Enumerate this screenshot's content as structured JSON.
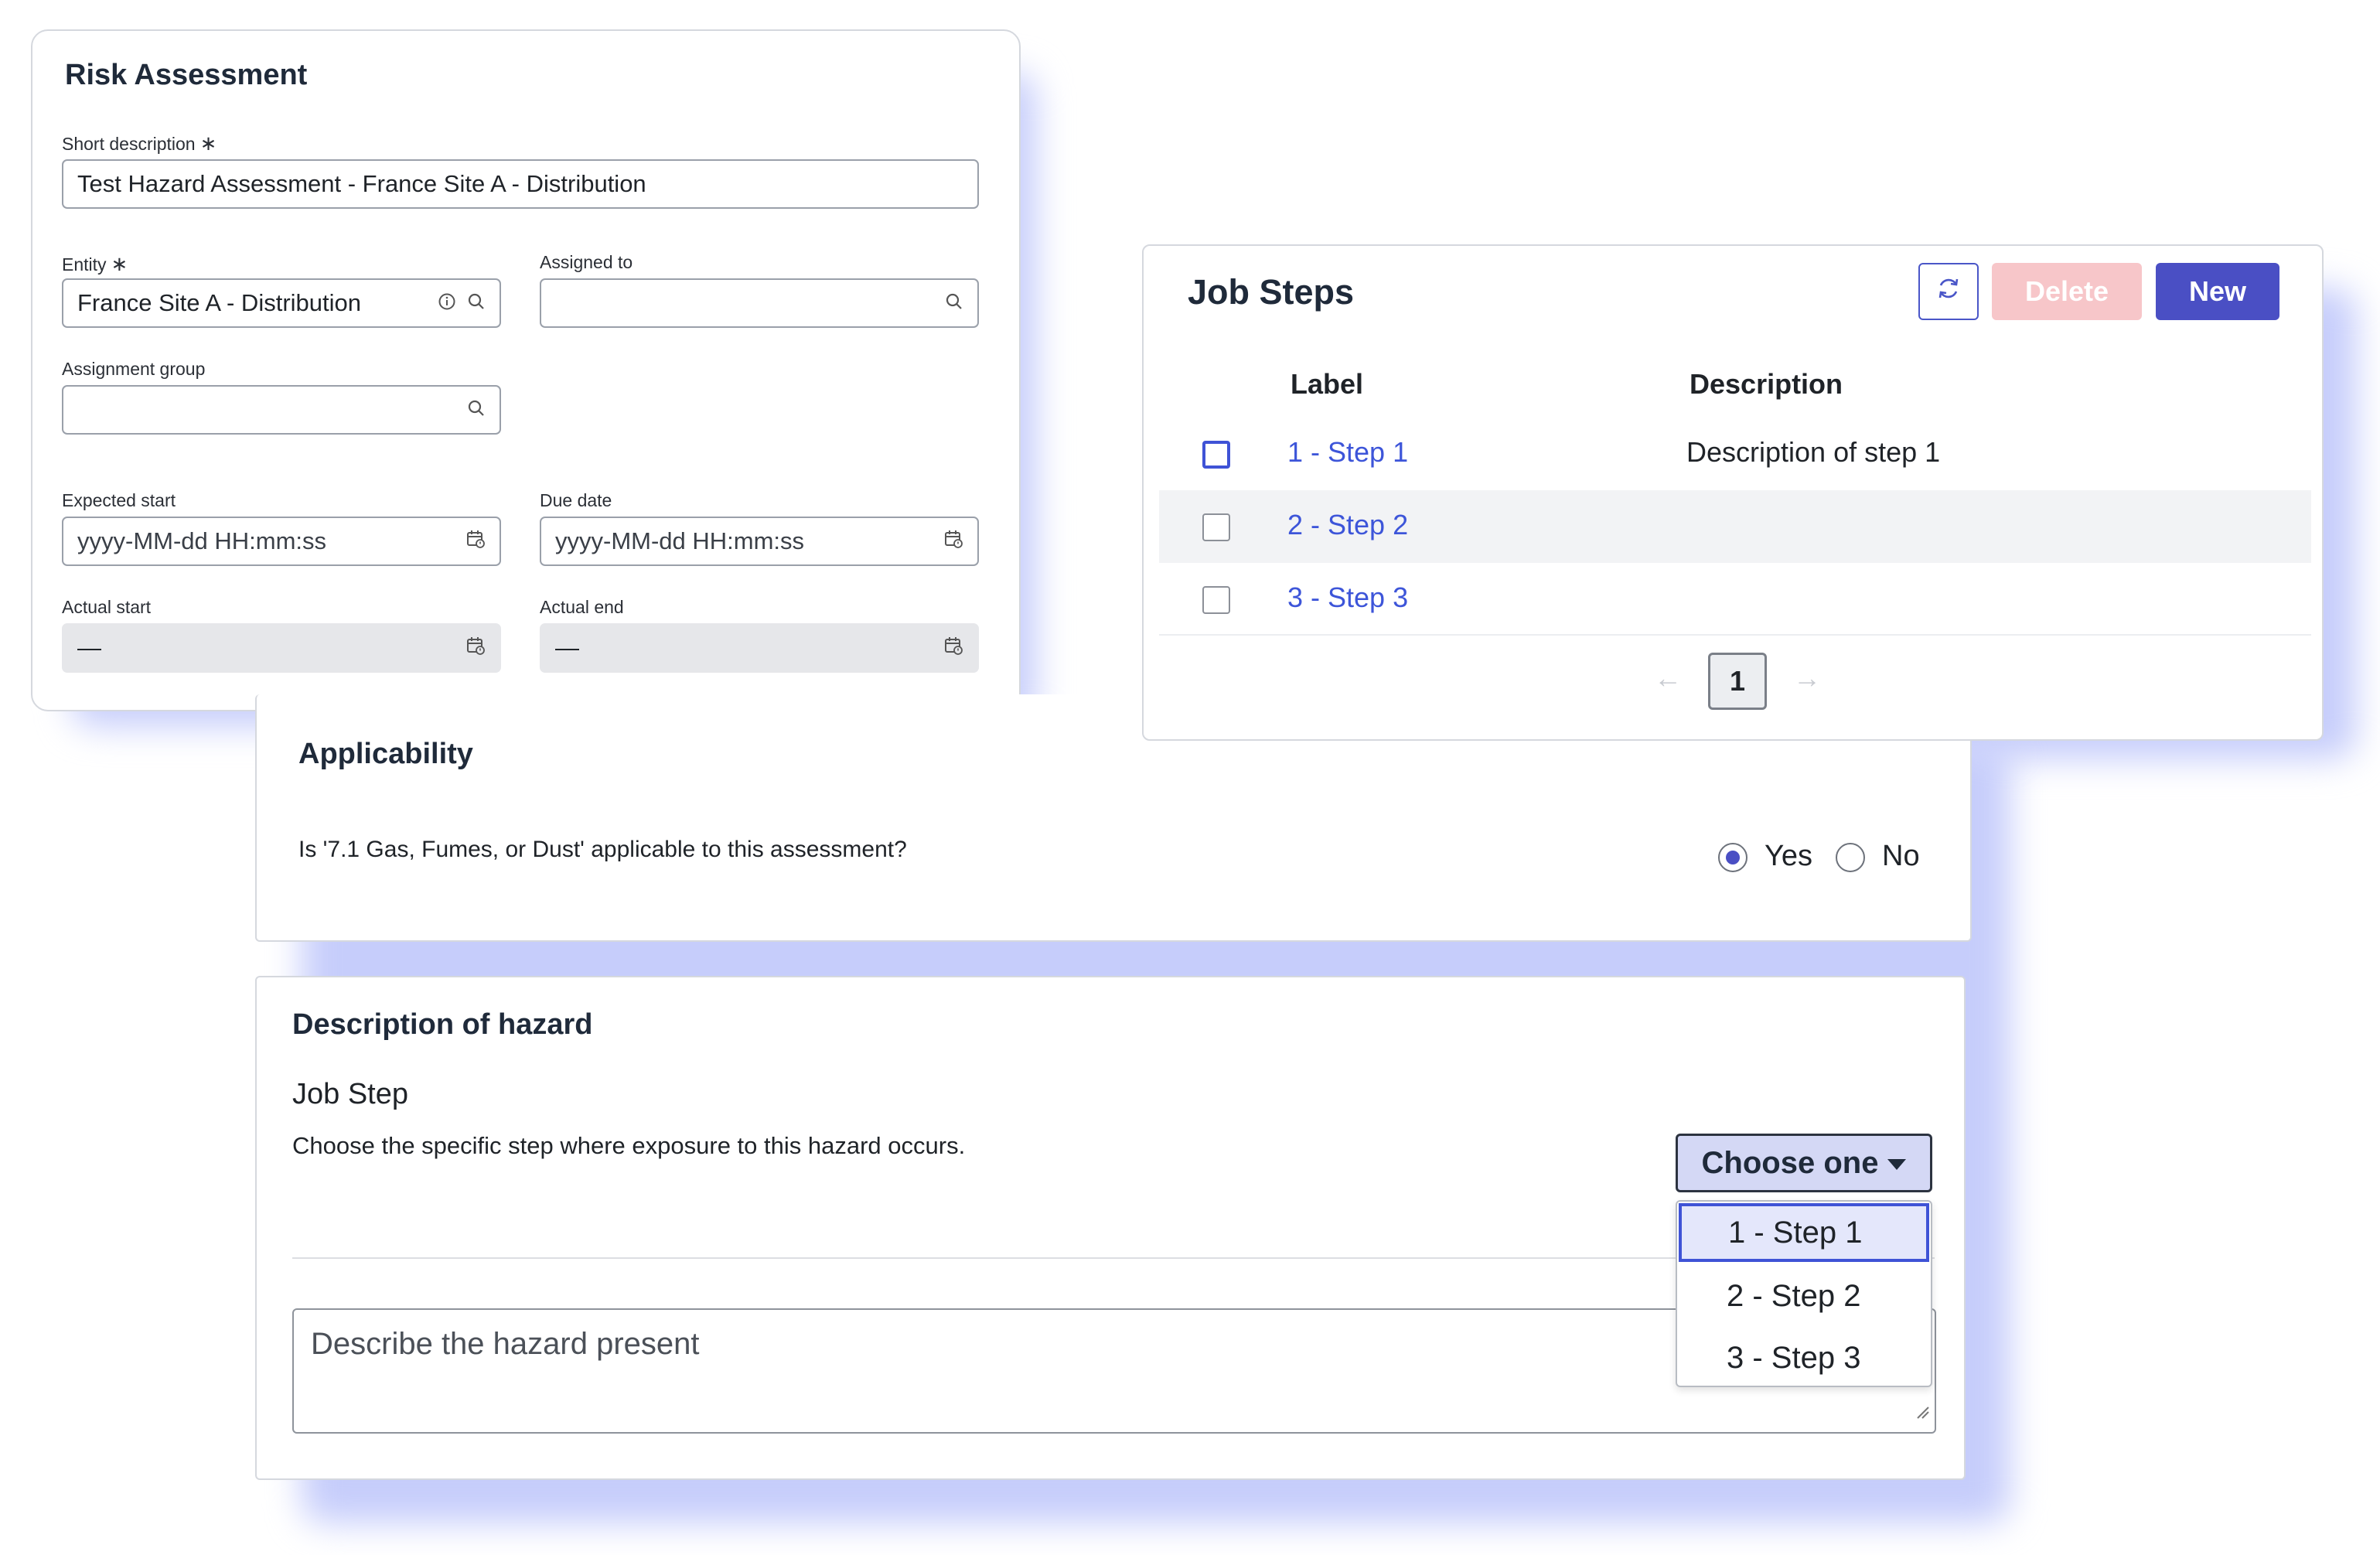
{
  "risk_assessment": {
    "title": "Risk Assessment",
    "short_description": {
      "label": "Short description",
      "required": "∗",
      "value": "Test Hazard Assessment - France Site A - Distribution"
    },
    "entity": {
      "label": "Entity",
      "required": "∗",
      "value": "France Site A - Distribution"
    },
    "assigned_to": {
      "label": "Assigned to",
      "value": ""
    },
    "assignment_group": {
      "label": "Assignment group",
      "value": ""
    },
    "expected_start": {
      "label": "Expected start",
      "placeholder": "yyyy-MM-dd HH:mm:ss"
    },
    "due_date": {
      "label": "Due date",
      "placeholder": "yyyy-MM-dd HH:mm:ss"
    },
    "actual_start": {
      "label": "Actual start",
      "value": "—"
    },
    "actual_end": {
      "label": "Actual end",
      "value": "—"
    }
  },
  "job_steps": {
    "title": "Job Steps",
    "delete_label": "Delete",
    "new_label": "New",
    "columns": {
      "label": "Label",
      "description": "Description"
    },
    "rows": [
      {
        "label": "1 - Step 1",
        "description": "Description of step 1"
      },
      {
        "label": "2 - Step 2",
        "description": ""
      },
      {
        "label": "3 - Step 3",
        "description": ""
      }
    ],
    "pagination": {
      "prev": "←",
      "current_page": "1",
      "next": "→"
    }
  },
  "applicability": {
    "title": "Applicability",
    "question": "Is '7.1 Gas, Fumes, or Dust' applicable to this assessment?",
    "options": {
      "yes": "Yes",
      "no": "No"
    },
    "selected": "Yes"
  },
  "hazard": {
    "title": "Description of hazard",
    "subtitle": "Job Step",
    "hint": "Choose the specific step where exposure to this hazard occurs.",
    "dropdown": {
      "button_label": "Choose one",
      "options": [
        "1 - Step 1",
        "2 - Step 2",
        "3 - Step 3"
      ],
      "highlighted": "1 - Step 1"
    },
    "textarea_placeholder": "Describe the hazard present"
  },
  "colors": {
    "accent": "#4a4fc4",
    "link": "#3d55d9",
    "delete_disabled": "#f7c6c9",
    "shadow": "#c6cdfb"
  }
}
